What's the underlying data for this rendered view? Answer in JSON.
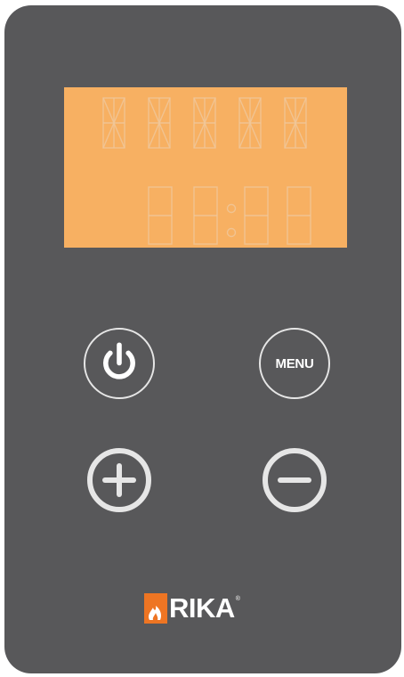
{
  "device": {
    "panel_color": "#58585a",
    "display_color": "#f7b062",
    "segment_color": "#f0c79a"
  },
  "buttons": {
    "power": {
      "icon": "power-icon"
    },
    "menu": {
      "label": "MENU"
    },
    "plus": {
      "icon": "plus-icon"
    },
    "minus": {
      "icon": "minus-icon"
    }
  },
  "brand": {
    "name": "RIKA",
    "registered": "®",
    "accent_color": "#ee7523",
    "icon": "flame-icon"
  }
}
